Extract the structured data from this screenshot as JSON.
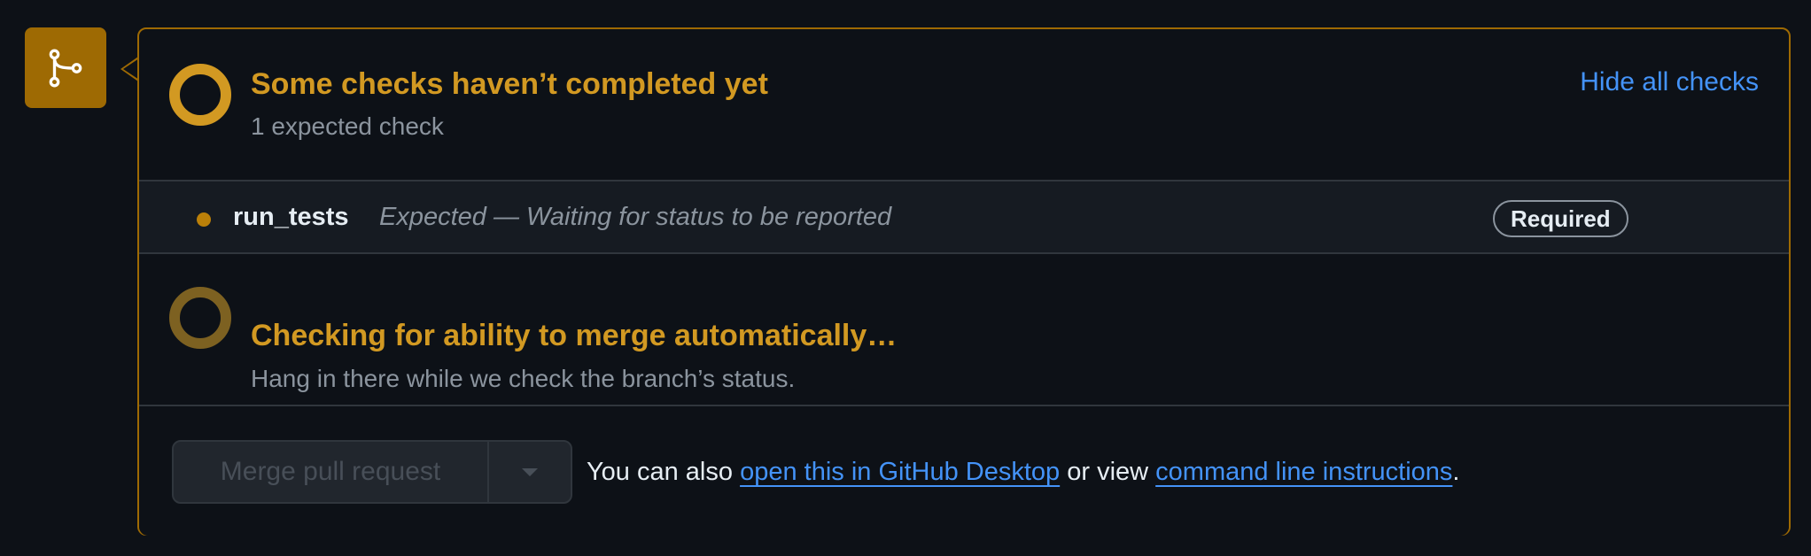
{
  "colors": {
    "background": "#0d1117",
    "accent_attention": "#d29922",
    "accent_attention_muted": "#7d6121",
    "link": "#4493f8",
    "border": "#30363d",
    "badge_bg": "#9e6a03"
  },
  "merge_icon": {
    "icon": "git-branch-icon"
  },
  "checks": {
    "status_icon": "pending-ring-icon",
    "title": "Some checks haven’t completed yet",
    "subtitle": "1 expected check",
    "toggle_label": "Hide all checks"
  },
  "check_items": [
    {
      "status_icon": "pending-dot-icon",
      "name": "run_tests",
      "description": "Expected — Waiting for status to be reported",
      "badge": "Required"
    }
  ],
  "mergeability": {
    "status_icon": "pending-ring-icon",
    "title": "Checking for ability to merge automatically…",
    "subtitle": "Hang in there while we check the branch’s status."
  },
  "actions": {
    "merge_button_label": "Merge pull request",
    "dropdown_icon": "caret-down-icon",
    "text_prefix": "You can also ",
    "desktop_link": "open this in GitHub Desktop",
    "text_middle": " or view ",
    "cli_link": "command line instructions",
    "text_suffix": "."
  }
}
